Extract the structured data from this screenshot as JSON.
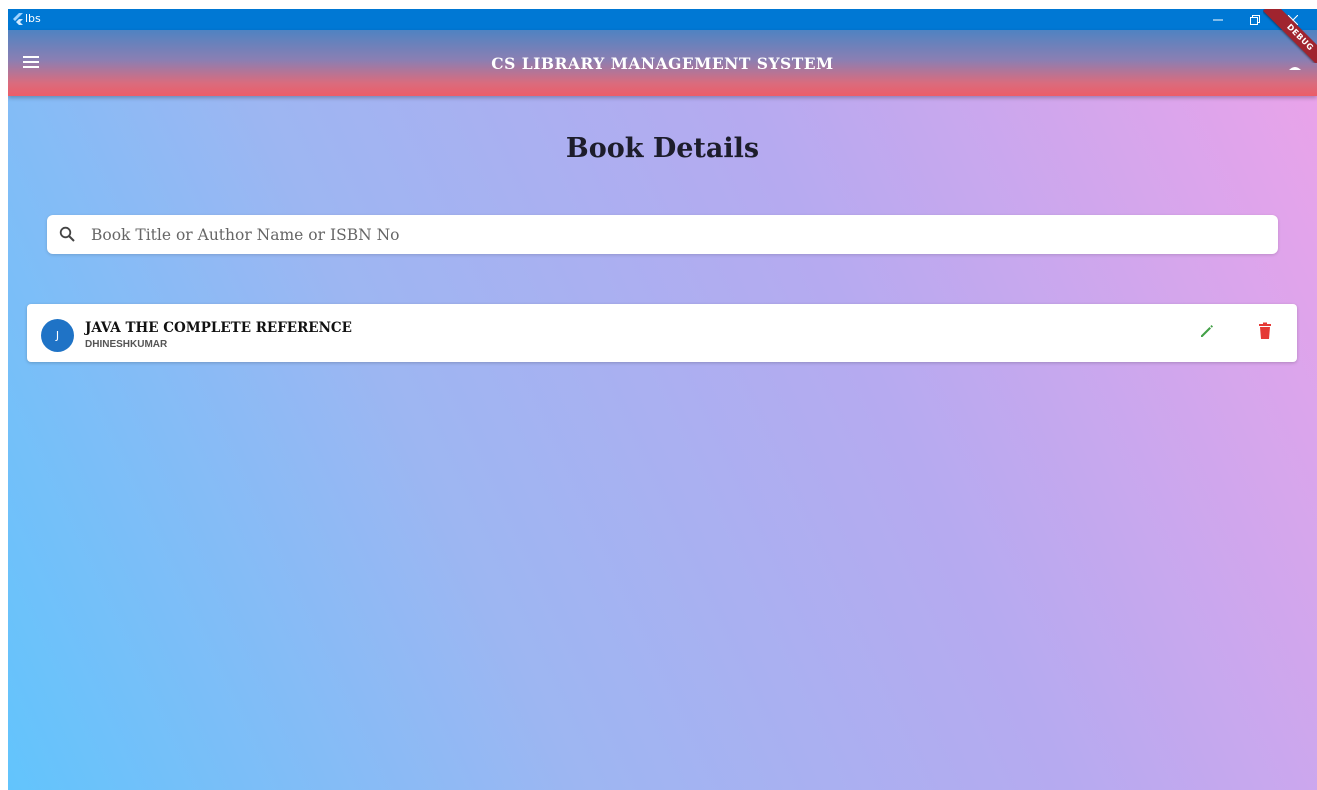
{
  "window": {
    "title": "lbs",
    "accent": "#0078d4",
    "controls": [
      "minimize",
      "restore",
      "close"
    ]
  },
  "appbar": {
    "title": "CS LIBRARY MANAGEMENT SYSTEM",
    "menu_icon": "hamburger-menu-icon",
    "debug_banner": "DEBUG",
    "colors": {
      "top": "#4f83c2",
      "bottom": "#ec5d68"
    }
  },
  "main": {
    "page_title": "Book Details",
    "search": {
      "placeholder": "Book Title or Author Name or ISBN No",
      "value": "",
      "icon": "search-icon"
    },
    "books": [
      {
        "avatar_letter": "J",
        "title": "JAVA THE COMPLETE REFERENCE",
        "author": "DHINESHKUMAR",
        "actions": {
          "edit_icon": "pencil-icon",
          "delete_icon": "trash-icon"
        }
      }
    ],
    "colors": {
      "background_start": "#62c4fc",
      "background_end": "#e9a3ea",
      "avatar": "#1f73c6",
      "edit": "#43a047",
      "delete": "#e53935"
    }
  }
}
